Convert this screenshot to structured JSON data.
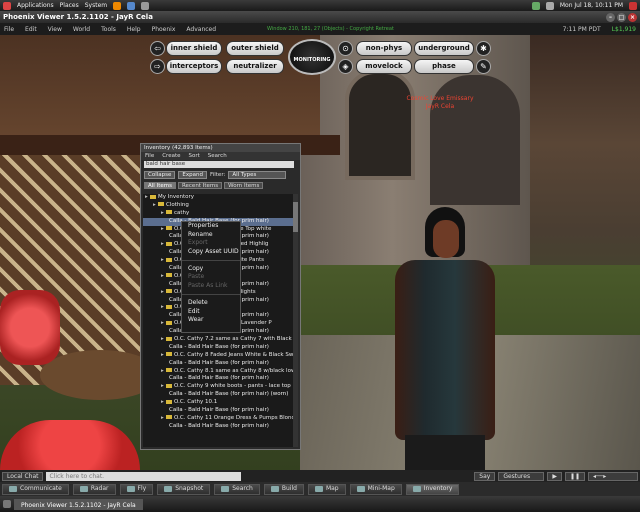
{
  "gnome_panel": {
    "menus": [
      "Applications",
      "Places",
      "System"
    ],
    "clock": "Mon Jul 18, 10:11 PM"
  },
  "window": {
    "title": "Phoenix Viewer 1.5.2.1102 - JayR Cela"
  },
  "menubar": {
    "items": [
      "File",
      "Edit",
      "View",
      "World",
      "Tools",
      "Help",
      "Phoenix",
      "Advanced"
    ],
    "status": "Window 210, 181, 27 (Objects) - Copyright Retreat",
    "time": "7:11 PM PDT",
    "balance": "L$1,919"
  },
  "hud": {
    "row1": [
      "inner shield",
      "outer shield",
      "non-phys",
      "underground"
    ],
    "row2": [
      "interceptors",
      "neutralizer",
      "movelock",
      "phase"
    ],
    "center": "MONITORING"
  },
  "scene": {
    "name_tag_line1": "Cosmic Love Emissary",
    "name_tag_line2": "JayR Cela"
  },
  "inventory": {
    "title": "Inventory (42,893 Items)",
    "menu": [
      "File",
      "Create",
      "Sort",
      "Search"
    ],
    "search_value": "bald hair base",
    "collapse_label": "Collapse",
    "expand_label": "Expand",
    "filter_label": "Filter:",
    "filter_value": "All Types",
    "tabs": [
      "All Items",
      "Recent Items",
      "Worn Items"
    ],
    "rows": [
      {
        "indent": 0,
        "folder": true,
        "label": "My Inventory"
      },
      {
        "indent": 1,
        "folder": true,
        "label": "Clothing"
      },
      {
        "indent": 2,
        "folder": true,
        "label": "cathy"
      },
      {
        "indent": 3,
        "folder": false,
        "label": "Calla - Bald Hair Base (for prim hair)",
        "selected": true
      },
      {
        "indent": 2,
        "folder": true,
        "label": "O.C. Cathy 1 - Black Lace Top white"
      },
      {
        "indent": 3,
        "folder": false,
        "label": "Calla - Bald Hair Base (for prim hair)"
      },
      {
        "indent": 2,
        "folder": true,
        "label": "O.C. Cathy 2 - Black w/Red Highlig"
      },
      {
        "indent": 3,
        "folder": false,
        "label": "Calla - Bald Hair Base (for prim hair)"
      },
      {
        "indent": 2,
        "folder": true,
        "label": "O.C. Cathy 3 - Boots White Pants"
      },
      {
        "indent": 3,
        "folder": false,
        "label": "Calla - Bald Hair Base (for prim hair)"
      },
      {
        "indent": 2,
        "folder": true,
        "label": "O.C. Cathy 4 - Blue Lace"
      },
      {
        "indent": 3,
        "folder": false,
        "label": "Calla - Bald Hair Base (for prim hair)"
      },
      {
        "indent": 2,
        "folder": true,
        "label": "O.C. Cathy 5 - Blue Highlights"
      },
      {
        "indent": 3,
        "folder": false,
        "label": "Calla - Bald Hair Base (for prim hair)"
      },
      {
        "indent": 2,
        "folder": true,
        "label": "O.C. Cathy 6 - Sexy"
      },
      {
        "indent": 3,
        "folder": false,
        "label": "Calla - Bald Hair Base (for prim hair)"
      },
      {
        "indent": 2,
        "folder": true,
        "label": "O.C. Cathy 6.5 Print Top Lavender P"
      },
      {
        "indent": 3,
        "folder": false,
        "label": "Calla - Bald Hair Base (for prim hair)"
      },
      {
        "indent": 2,
        "folder": true,
        "label": "O.C. Cathy 7.2 same as Cathy 7 with Black Low C"
      },
      {
        "indent": 3,
        "folder": false,
        "label": "Calla - Bald Hair Base (for prim hair)"
      },
      {
        "indent": 2,
        "folder": true,
        "label": "O.C. Cathy 8 Faded Jeans White & Black Sweater"
      },
      {
        "indent": 3,
        "folder": false,
        "label": "Calla - Bald Hair Base (for prim hair)"
      },
      {
        "indent": 2,
        "folder": true,
        "label": "O.C. Cathy 8.1 same as Cathy 8 w/black low cut"
      },
      {
        "indent": 3,
        "folder": false,
        "label": "Calla - Bald Hair Base (for prim hair)"
      },
      {
        "indent": 2,
        "folder": true,
        "label": "O.C. Cathy 9 white boots - pants - lace top"
      },
      {
        "indent": 3,
        "folder": false,
        "label": "Calla - Bald Hair Base (for prim hair) (worn)"
      },
      {
        "indent": 2,
        "folder": true,
        "label": "O.C. Cathy 10.1"
      },
      {
        "indent": 3,
        "folder": false,
        "label": "Calla - Bald Hair Base (for prim hair)"
      },
      {
        "indent": 2,
        "folder": true,
        "label": "O.C. Cathy 11 Orange Dress & Pumps Blonded Ha"
      },
      {
        "indent": 3,
        "folder": false,
        "label": "Calla - Bald Hair Base (for prim hair)"
      }
    ]
  },
  "context_menu": {
    "items": [
      {
        "label": "Properties",
        "disabled": false
      },
      {
        "label": "Rename",
        "disabled": false
      },
      {
        "label": "Export",
        "disabled": true
      },
      {
        "label": "Copy Asset UUID",
        "disabled": false
      },
      {
        "label": "Copy",
        "disabled": false,
        "sep_before": true
      },
      {
        "label": "Paste",
        "disabled": true
      },
      {
        "label": "Paste As Link",
        "disabled": true
      },
      {
        "label": "Delete",
        "disabled": false,
        "sep_before": true
      },
      {
        "label": "Edit",
        "disabled": false
      },
      {
        "label": "Wear",
        "disabled": false
      }
    ]
  },
  "chatbar": {
    "local_chat": "Local Chat",
    "placeholder": "Click here to chat.",
    "say": "Say",
    "gestures": "Gestures"
  },
  "toolbar": {
    "buttons": [
      "Communicate",
      "Radar",
      "Fly",
      "Snapshot",
      "Search",
      "Build",
      "Map",
      "Mini-Map",
      "Inventory"
    ]
  },
  "taskbar": {
    "items": [
      "Phoenix Viewer 1.5.2.1102 - JayR Cela"
    ]
  },
  "colors": {
    "accent": "#5b6e8f",
    "status_green": "#44aa44",
    "folder": "#d8b83a"
  }
}
